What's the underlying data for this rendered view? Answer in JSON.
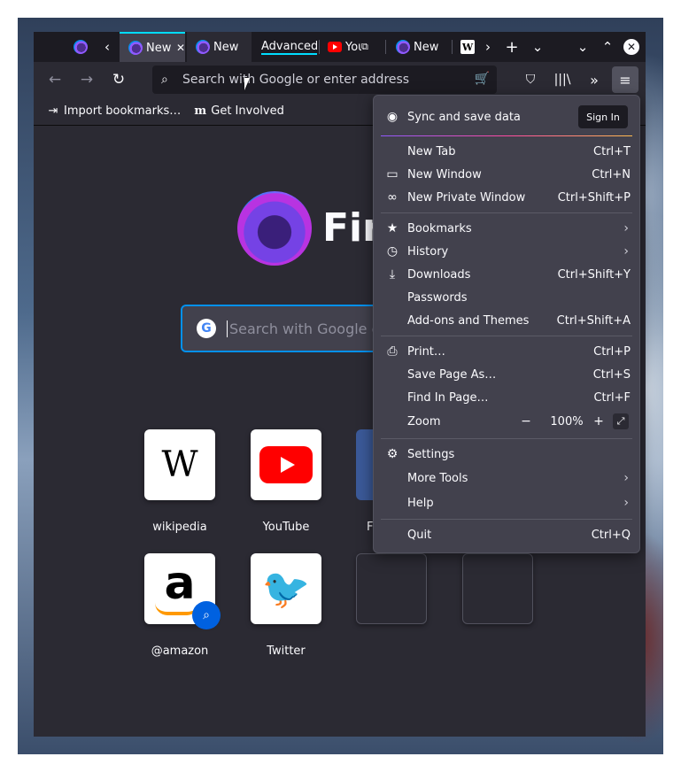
{
  "tabs": [
    {
      "label": "",
      "icon": "pinned-firefox-icon"
    },
    {
      "label": "New Tab",
      "selected": true
    },
    {
      "label": "New",
      "muted": true
    },
    {
      "label": "Advanced"
    },
    {
      "label": "YouTube",
      "icon": "youtube-icon"
    },
    {
      "label": "New Tab"
    },
    {
      "label": "W"
    }
  ],
  "tabstrip": {
    "scroll_left": "‹",
    "scroll_right": "›",
    "new_tab": "+",
    "list_tabs": "⌄",
    "minimize": "⌄",
    "maximize": "⌃",
    "close": "✕"
  },
  "navbar": {
    "back": "←",
    "forward": "→",
    "reload": "↻",
    "url_placeholder": "Search with Google or enter address"
  },
  "bookmarks": [
    {
      "label": "Import bookmarks…"
    },
    {
      "label": "Get Involved"
    }
  ],
  "newtab": {
    "wordmark": "Firefox",
    "search_placeholder": "Search with Google or enter address",
    "tiles": [
      {
        "label": "wikipedia"
      },
      {
        "label": "YouTube"
      },
      {
        "label": "F"
      },
      {
        "label": "@amazon"
      },
      {
        "label": "Twitter"
      }
    ]
  },
  "menu": {
    "sync_label": "Sync and save data",
    "sign_in": "Sign In",
    "new_tab": "New Tab",
    "new_tab_key": "Ctrl+T",
    "new_window": "New Window",
    "new_window_key": "Ctrl+N",
    "new_private": "New Private Window",
    "new_private_key": "Ctrl+Shift+P",
    "bookmarks": "Bookmarks",
    "history": "History",
    "downloads": "Downloads",
    "downloads_key": "Ctrl+Shift+Y",
    "passwords": "Passwords",
    "addons": "Add-ons and Themes",
    "addons_key": "Ctrl+Shift+A",
    "print": "Print…",
    "print_key": "Ctrl+P",
    "save_page": "Save Page As…",
    "save_page_key": "Ctrl+S",
    "find": "Find In Page…",
    "find_key": "Ctrl+F",
    "zoom": "Zoom",
    "zoom_out": "−",
    "zoom_value": "100%",
    "zoom_in": "+",
    "settings": "Settings",
    "more_tools": "More Tools",
    "help": "Help",
    "quit": "Quit",
    "quit_key": "Ctrl+Q"
  },
  "colors": {
    "accent": "#00ddff",
    "focus_blue": "#0090ed",
    "toolbar": "#2b2a33",
    "menu_bg": "#42414d"
  }
}
